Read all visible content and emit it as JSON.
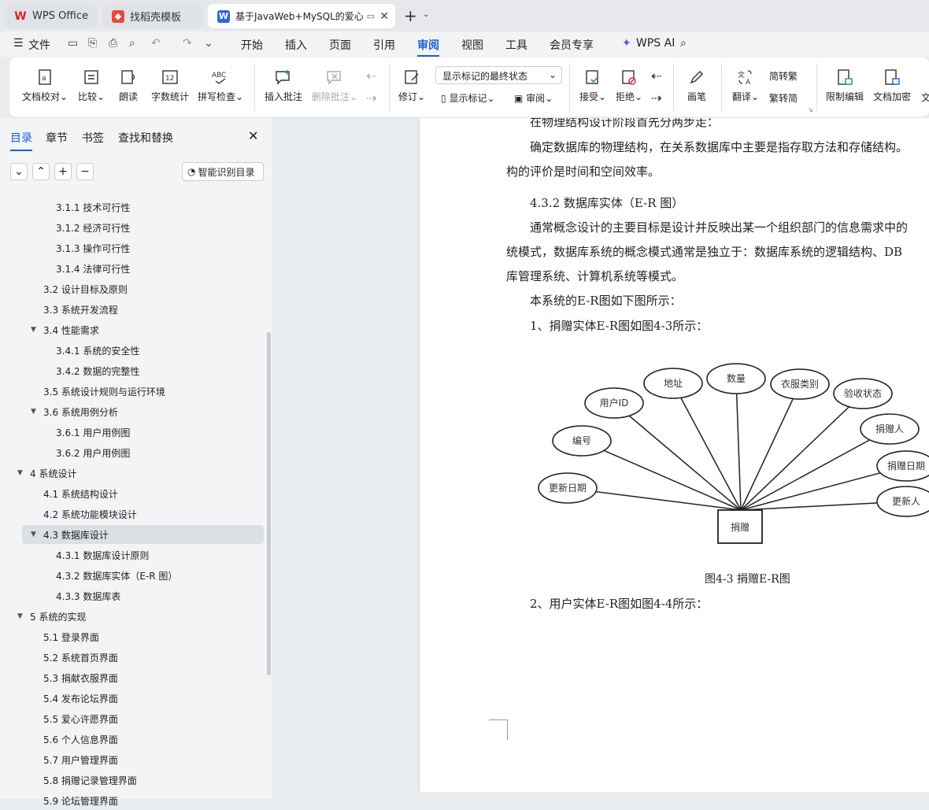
{
  "tabs": [
    {
      "label": "WPS Office"
    },
    {
      "label": "找稻壳模板"
    },
    {
      "label": "基于JavaWeb+MySQL的爱心"
    }
  ],
  "menu": {
    "file": "文件",
    "items": [
      "开始",
      "插入",
      "页面",
      "引用",
      "审阅",
      "视图",
      "工具",
      "会员专享"
    ],
    "ai": "WPS AI"
  },
  "ribbon": {
    "doc_check": "文档校对",
    "compare": "比较",
    "read": "朗读",
    "word_count": "字数统计",
    "spell": "拼写检查",
    "insert_comment": "插入批注",
    "delete_comment": "删除批注",
    "track": "修订",
    "markup_select": "显示标记的最终状态",
    "show_markup": "显示标记",
    "review": "审阅",
    "accept": "接受",
    "reject": "拒绝",
    "pen": "画笔",
    "translate": "翻译",
    "to_trad": "转繁",
    "to_simp": "转简",
    "restrict": "限制编辑",
    "encrypt": "文档加密",
    "more": "文"
  },
  "panel": {
    "tabs": [
      "目录",
      "章节",
      "书签",
      "查找和替换"
    ],
    "smart": "智能识别目录"
  },
  "toc": [
    {
      "text": "3.1.1  技术可行性",
      "level": 3
    },
    {
      "text": "3.1.2 经济可行性",
      "level": 3
    },
    {
      "text": "3.1.3  操作可行性",
      "level": 3
    },
    {
      "text": "3.1.4  法律可行性",
      "level": 3
    },
    {
      "text": "3.2 设计目标及原则",
      "level": 2
    },
    {
      "text": "3.3 系统开发流程",
      "level": 2
    },
    {
      "text": "3.4  性能需求",
      "level": 2,
      "expand": true
    },
    {
      "text": "3.4.1  系统的安全性",
      "level": 3
    },
    {
      "text": "3.4.2  数据的完整性",
      "level": 3
    },
    {
      "text": "3.5 系统设计规则与运行环境",
      "level": 2
    },
    {
      "text": "3.6 系统用例分析",
      "level": 2,
      "expand": true
    },
    {
      "text": "3.6.1 用户用例图",
      "level": 3
    },
    {
      "text": "3.6.2 用户用例图",
      "level": 3
    },
    {
      "text": "4 系统设计",
      "level": 1,
      "expand": true
    },
    {
      "text": "4.1 系统结构设计",
      "level": 2
    },
    {
      "text": "4.2 系统功能模块设计",
      "level": 2
    },
    {
      "text": "4.3 数据库设计",
      "level": 2,
      "expand": true,
      "selected": true
    },
    {
      "text": "4.3.1  数据库设计原则",
      "level": 3
    },
    {
      "text": "4.3.2  数据库实体（E-R 图）",
      "level": 3
    },
    {
      "text": "4.3.3  数据库表",
      "level": 3
    },
    {
      "text": "5  系统的实现",
      "level": 1,
      "expand": true
    },
    {
      "text": "5.1 登录界面",
      "level": 2
    },
    {
      "text": "5.2 系统首页界面",
      "level": 2
    },
    {
      "text": "5.3 捐献衣服界面",
      "level": 2
    },
    {
      "text": "5.4 发布论坛界面",
      "level": 2
    },
    {
      "text": "5.5 爱心许愿界面",
      "level": 2
    },
    {
      "text": "5.6 个人信息界面",
      "level": 2
    },
    {
      "text": "5.7  用户管理界面",
      "level": 2
    },
    {
      "text": "5.8  捐赠记录管理界面",
      "level": 2
    },
    {
      "text": "5.9  论坛管理界面",
      "level": 2
    }
  ],
  "doc": {
    "line0": "在物理结构设计阶段首先分两步走：",
    "p1a": "确定数据库的物理结构，在关系数据库中主要是指存取方法和存储结构。",
    "p1b": "构的评价是时间和空间效率。",
    "heading": "4.3.2  数据库实体（E-R 图）",
    "p2a": "通常概念设计的主要目标是设计并反映出某一个组织部门的信息需求中的",
    "p2b": "统模式，数据库系统的概念模式通常是独立于：数据库系统的逻辑结构、DB",
    "p2c": "库管理系统、计算机系统等模式。",
    "p3": "本系统的E-R图如下图所示：",
    "p4": "1、捐赠实体E-R图如图4-3所示：",
    "caption": "图4-3 捐赠E-R图",
    "p5": "2、用户实体E-R图如图4-4所示："
  },
  "er": {
    "entity": "捐赠",
    "attributes": [
      "更新日期",
      "编号",
      "用户ID",
      "地址",
      "数量",
      "衣服类别",
      "验收状态",
      "捐赠人",
      "捐赠日期",
      "更新人"
    ]
  }
}
